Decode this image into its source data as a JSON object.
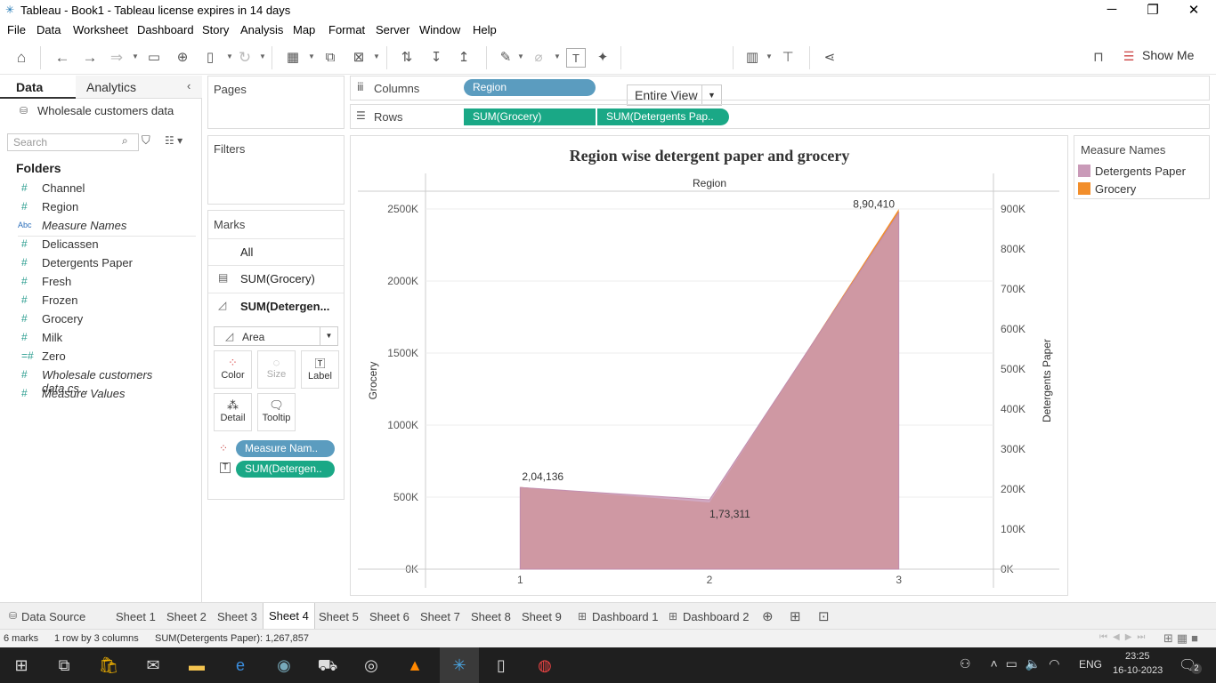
{
  "window": {
    "title": "Tableau - Book1 - Tableau license expires in 14 days",
    "minimize": "─",
    "restore": "❐",
    "close": "✕"
  },
  "menu": [
    "File",
    "Data",
    "Worksheet",
    "Dashboard",
    "Story",
    "Analysis",
    "Map",
    "Format",
    "Server",
    "Window",
    "Help"
  ],
  "toolbar": {
    "fit_label": "Entire View",
    "show_me": "Show Me"
  },
  "left_panel": {
    "tab_data": "Data",
    "tab_analytics": "Analytics",
    "datasource": "Wholesale customers data",
    "search_placeholder": "Search",
    "folders_label": "Folders",
    "fields": [
      {
        "type": "#",
        "name": "Channel",
        "italic": false
      },
      {
        "type": "#",
        "name": "Region",
        "italic": false
      },
      {
        "type": "Abc",
        "name": "Measure Names",
        "italic": true
      },
      {
        "type": "#",
        "name": "Delicassen",
        "italic": false
      },
      {
        "type": "#",
        "name": "Detergents Paper",
        "italic": false
      },
      {
        "type": "#",
        "name": "Fresh",
        "italic": false
      },
      {
        "type": "#",
        "name": "Frozen",
        "italic": false
      },
      {
        "type": "#",
        "name": "Grocery",
        "italic": false
      },
      {
        "type": "#",
        "name": "Milk",
        "italic": false
      },
      {
        "type": "=#",
        "name": "Zero",
        "italic": false
      },
      {
        "type": "#",
        "name": "Wholesale customers data.cs...",
        "italic": true
      },
      {
        "type": "#",
        "name": "Measure Values",
        "italic": true
      }
    ]
  },
  "shelves": {
    "pages": "Pages",
    "filters": "Filters",
    "marks": "Marks",
    "marks_all": "All",
    "marks_grocery": "SUM(Grocery)",
    "marks_detergents": "SUM(Detergen...",
    "mark_type": "Area",
    "btn_color": "Color",
    "btn_size": "Size",
    "btn_label": "Label",
    "btn_detail": "Detail",
    "btn_tooltip": "Tooltip",
    "pill_measure_names": "Measure Nam..",
    "pill_sum_detergents": "SUM(Detergen..",
    "columns_label": "Columns",
    "rows_label": "Rows",
    "columns_pill": "Region",
    "rows_pill1": "SUM(Grocery)",
    "rows_pill2": "SUM(Detergents Pap.."
  },
  "legend": {
    "title": "Measure Names",
    "items": [
      {
        "name": "Detergents Paper",
        "color": "#c99ab8"
      },
      {
        "name": "Grocery",
        "color": "#f28e2b"
      }
    ]
  },
  "chart_data": {
    "type": "area",
    "title": "Region  wise detergent paper and grocery",
    "xlabel": "Region",
    "ylabel": "Grocery",
    "y2label": "Detergents Paper",
    "x": [
      1,
      2,
      3
    ],
    "series": [
      {
        "name": "Grocery",
        "axis": "left",
        "values": [
          570000,
          463000,
          2500000
        ],
        "color": "#f28e2b"
      },
      {
        "name": "Detergents Paper",
        "axis": "right",
        "values": [
          204136,
          173311,
          890410
        ],
        "color": "#c99ab8",
        "labels": [
          "2,04,136",
          "1,73,311",
          "8,90,410"
        ]
      }
    ],
    "ylim": [
      0,
      2500000
    ],
    "y2lim": [
      0,
      900000
    ],
    "yticks": [
      "0K",
      "500K",
      "1000K",
      "1500K",
      "2000K",
      "2500K"
    ],
    "y2ticks": [
      "0K",
      "100K",
      "200K",
      "300K",
      "400K",
      "500K",
      "600K",
      "700K",
      "800K",
      "900K"
    ],
    "xticks": [
      "1",
      "2",
      "3"
    ],
    "legend": "top-right",
    "grid": true
  },
  "sheets": {
    "data_source": "Data Source",
    "tabs": [
      "Sheet 1",
      "Sheet 2",
      "Sheet 3",
      "Sheet 4",
      "Sheet 5",
      "Sheet 6",
      "Sheet 7",
      "Sheet 8",
      "Sheet 9"
    ],
    "active": "Sheet 4",
    "dashboards": [
      "Dashboard 1",
      "Dashboard 2"
    ]
  },
  "status": {
    "marks": "6 marks",
    "shape": "1 row by 3 columns",
    "sum": "SUM(Detergents Paper): 1,267,857"
  },
  "taskbar": {
    "lang": "ENG",
    "time": "23:25",
    "date": "16-10-2023",
    "notif": "2"
  }
}
